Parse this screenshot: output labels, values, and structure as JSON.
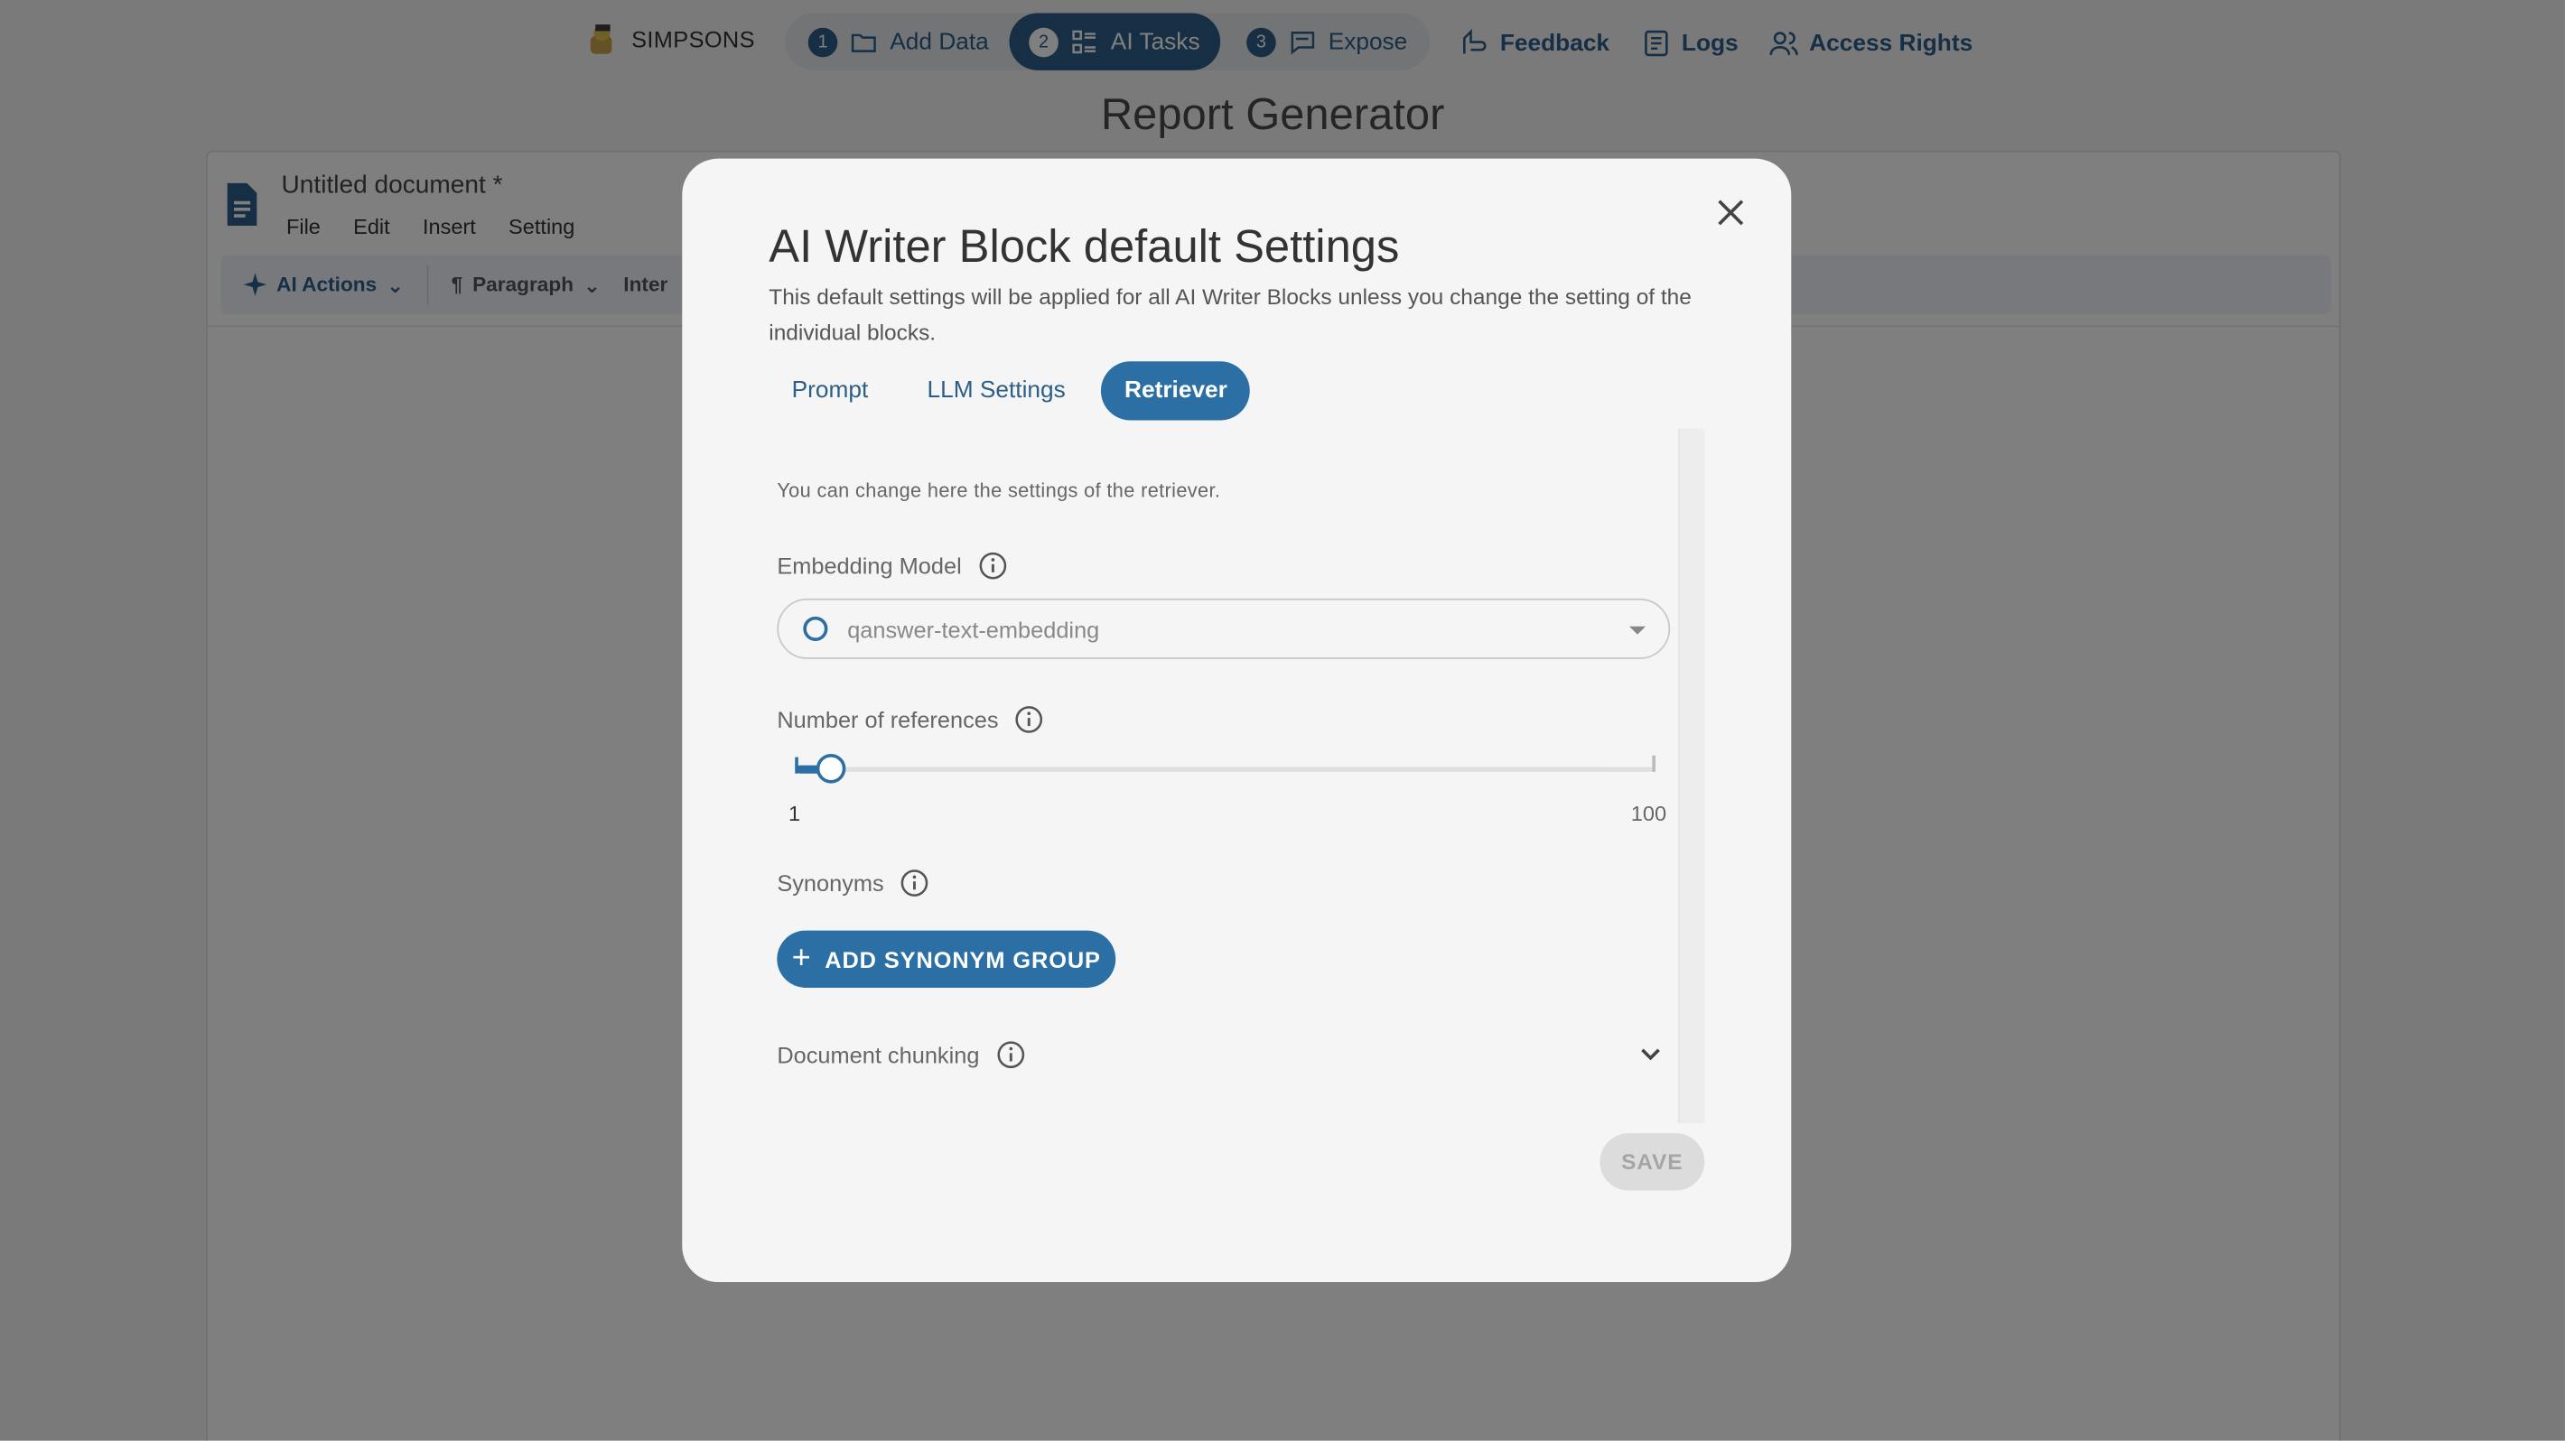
{
  "brand": {
    "name": "SIMPSONS"
  },
  "steps": [
    {
      "num": "1",
      "label": "Add Data",
      "icon": "folder-icon"
    },
    {
      "num": "2",
      "label": "AI Tasks",
      "icon": "tasks-icon"
    },
    {
      "num": "3",
      "label": "Expose",
      "icon": "chat-icon"
    }
  ],
  "nav": {
    "feedback": "Feedback",
    "logs": "Logs",
    "access": "Access Rights"
  },
  "page_title": "Report Generator",
  "document": {
    "title": "Untitled document *",
    "menu": [
      "File",
      "Edit",
      "Insert",
      "Setting"
    ],
    "toolbar": {
      "ai_actions": "AI Actions",
      "paragraph": "Paragraph",
      "inter": "Inter"
    }
  },
  "modal": {
    "title": "AI Writer Block default Settings",
    "description": "This default settings will be applied for all AI Writer Blocks unless you change the setting of the individual blocks.",
    "tabs": [
      "Prompt",
      "LLM Settings",
      "Retriever"
    ],
    "active_tab": "Retriever",
    "intro": "You can change here the settings of the retriever.",
    "embedding_label": "Embedding Model",
    "embedding_value": "qanswer-text-embedding",
    "references_label": "Number of references",
    "slider": {
      "min": "1",
      "max": "100",
      "value": 5
    },
    "synonyms_label": "Synonyms",
    "add_synonym": "ADD SYNONYM GROUP",
    "chunking_label": "Document chunking",
    "save": "SAVE"
  },
  "colors": {
    "primary": "#2c6fa4",
    "nav": "#2c5f88",
    "overlay": "rgba(0,0,0,0.5)"
  }
}
